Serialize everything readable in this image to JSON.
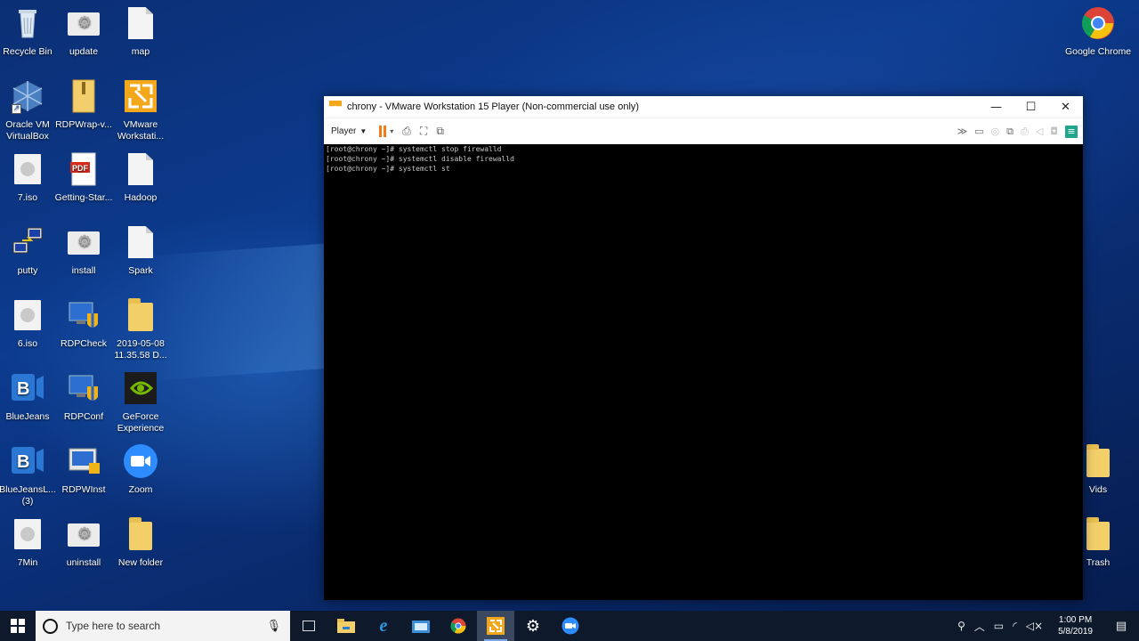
{
  "desktop": {
    "icons_left": [
      {
        "label": "Recycle Bin",
        "icon": "recycle-bin-icon"
      },
      {
        "label": "update",
        "icon": "settings-file-icon"
      },
      {
        "label": "map",
        "icon": "blank-file-icon"
      },
      {
        "label": "Oracle VM VirtualBox",
        "icon": "virtualbox-icon"
      },
      {
        "label": "RDPWrap-v...",
        "icon": "zip-folder-icon"
      },
      {
        "label": "VMware Workstati...",
        "icon": "vmware-icon"
      },
      {
        "label": "7.iso",
        "icon": "disc-image-icon"
      },
      {
        "label": "Getting-Star...",
        "icon": "pdf-icon"
      },
      {
        "label": "Hadoop",
        "icon": "blank-file-icon"
      },
      {
        "label": "putty",
        "icon": "putty-icon"
      },
      {
        "label": "install",
        "icon": "settings-file-icon"
      },
      {
        "label": "Spark",
        "icon": "blank-file-icon"
      },
      {
        "label": "6.iso",
        "icon": "disc-image-icon"
      },
      {
        "label": "RDPCheck",
        "icon": "rdp-shield-icon"
      },
      {
        "label": "2019-05-08 11.35.58 D...",
        "icon": "folder-icon"
      },
      {
        "label": "BlueJeans",
        "icon": "bluejeans-icon"
      },
      {
        "label": "RDPConf",
        "icon": "rdp-shield-icon"
      },
      {
        "label": "GeForce Experience",
        "icon": "geforce-icon"
      },
      {
        "label": "BlueJeansL... (3)",
        "icon": "bluejeans-icon"
      },
      {
        "label": "RDPWInst",
        "icon": "rdp-installer-icon"
      },
      {
        "label": "Zoom",
        "icon": "zoom-icon"
      },
      {
        "label": "7Min",
        "icon": "disc-image-icon"
      },
      {
        "label": "uninstall",
        "icon": "settings-file-icon"
      },
      {
        "label": "New folder",
        "icon": "folder-icon"
      }
    ],
    "icons_right": [
      {
        "label": "Google Chrome",
        "icon": "chrome-icon"
      },
      {
        "label": "Vids",
        "icon": "folder-icon"
      },
      {
        "label": "Trash",
        "icon": "folder-icon"
      }
    ]
  },
  "vm_window": {
    "title": "chrony - VMware Workstation 15 Player (Non-commercial use only)",
    "player_menu": "Player",
    "console_lines": [
      "[root@chrony ~]# systemctl stop firewalld",
      "[root@chrony ~]# systemctl disable firewalld",
      "[root@chrony ~]# systemctl st"
    ]
  },
  "taskbar": {
    "search_placeholder": "Type here to search",
    "time": "1:00 PM",
    "date": "5/8/2019"
  }
}
